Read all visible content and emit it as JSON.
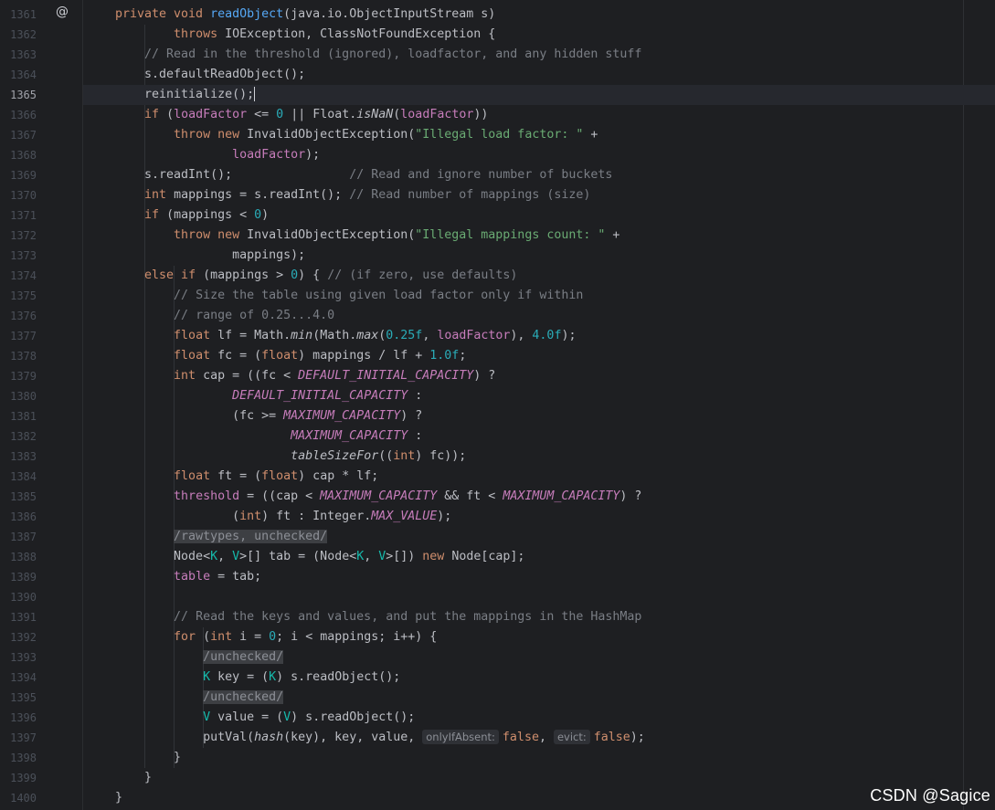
{
  "editor": {
    "gutter_icon": "at-override-icon",
    "active_line": 1365,
    "watermark": "CSDN @Sagice",
    "lines": [
      {
        "n": "1361",
        "html": "<span class=\"kw\">private void </span><span class=\"fn\">readObject</span>(java.io.ObjectInputStream s)"
      },
      {
        "n": "1362",
        "html": "        <span class=\"kw\">throws </span>IOException, ClassNotFoundException {"
      },
      {
        "n": "1363",
        "html": "    <span class=\"cm\">// Read in the threshold (ignored), loadfactor, and any hidden stuff</span>"
      },
      {
        "n": "1364",
        "html": "    s.defaultReadObject();"
      },
      {
        "n": "1365",
        "html": "    reinitialize();<span class=\"caret\"></span>"
      },
      {
        "n": "1366",
        "html": "    <span class=\"kw\">if </span>(<span class=\"field\">loadFactor</span> &lt;= <span class=\"num\">0</span> || Float.<span class=\"it\">isNaN</span>(<span class=\"field\">loadFactor</span>))"
      },
      {
        "n": "1367",
        "html": "        <span class=\"kw\">throw new </span>InvalidObjectException(<span class=\"str\">\"Illegal load factor: \"</span> +"
      },
      {
        "n": "1368",
        "html": "                <span class=\"field\">loadFactor</span>);"
      },
      {
        "n": "1369",
        "html": "    s.readInt();                <span class=\"cm\">// Read and ignore number of buckets</span>"
      },
      {
        "n": "1370",
        "html": "    <span class=\"kw\">int </span>mappings = s.readInt(); <span class=\"cm\">// Read number of mappings (size)</span>"
      },
      {
        "n": "1371",
        "html": "    <span class=\"kw\">if </span>(mappings &lt; <span class=\"num\">0</span>)"
      },
      {
        "n": "1372",
        "html": "        <span class=\"kw\">throw new </span>InvalidObjectException(<span class=\"str\">\"Illegal mappings count: \"</span> +"
      },
      {
        "n": "1373",
        "html": "                mappings);"
      },
      {
        "n": "1374",
        "html": "    <span class=\"kw\">else if </span>(mappings &gt; <span class=\"num\">0</span>) { <span class=\"cm\">// (if zero, use defaults)</span>"
      },
      {
        "n": "1375",
        "html": "        <span class=\"cm\">// Size the table using given load factor only if within</span>"
      },
      {
        "n": "1376",
        "html": "        <span class=\"cm\">// range of 0.25...4.0</span>"
      },
      {
        "n": "1377",
        "html": "        <span class=\"kw\">float </span>lf = Math.<span class=\"it\">min</span>(Math.<span class=\"it\">max</span>(<span class=\"num\">0.25f</span>, <span class=\"field\">loadFactor</span>), <span class=\"num\">4.0f</span>);"
      },
      {
        "n": "1378",
        "html": "        <span class=\"kw\">float </span>fc = (<span class=\"kw\">float</span>) mappings / lf + <span class=\"num\">1.0f</span>;"
      },
      {
        "n": "1379",
        "html": "        <span class=\"kw\">int </span>cap = ((fc &lt; <span class=\"const\">DEFAULT_INITIAL_CAPACITY</span>) ?"
      },
      {
        "n": "1380",
        "html": "                <span class=\"const\">DEFAULT_INITIAL_CAPACITY</span> :"
      },
      {
        "n": "1381",
        "html": "                (fc &gt;= <span class=\"const\">MAXIMUM_CAPACITY</span>) ?"
      },
      {
        "n": "1382",
        "html": "                        <span class=\"const\">MAXIMUM_CAPACITY</span> :"
      },
      {
        "n": "1383",
        "html": "                        <span class=\"it\">tableSizeFor</span>((<span class=\"kw\">int</span>) fc));"
      },
      {
        "n": "1384",
        "html": "        <span class=\"kw\">float </span>ft = (<span class=\"kw\">float</span>) cap * lf;"
      },
      {
        "n": "1385",
        "html": "        <span class=\"field\">threshold</span> = ((cap &lt; <span class=\"const\">MAXIMUM_CAPACITY</span> &amp;&amp; ft &lt; <span class=\"const\">MAXIMUM_CAPACITY</span>) ?"
      },
      {
        "n": "1386",
        "html": "                (<span class=\"kw\">int</span>) ft : Integer.<span class=\"const\">MAX_VALUE</span>);"
      },
      {
        "n": "1387",
        "html": "        <span class=\"sup\">/rawtypes, unchecked/</span>"
      },
      {
        "n": "1388",
        "html": "        Node&lt;<span class=\"tp\">K</span>, <span class=\"tp\">V</span>&gt;[] tab = (Node&lt;<span class=\"tp\">K</span>, <span class=\"tp\">V</span>&gt;[]) <span class=\"kw\">new </span>Node[cap];"
      },
      {
        "n": "1389",
        "html": "        <span class=\"field\">table</span> = tab;"
      },
      {
        "n": "1390",
        "html": ""
      },
      {
        "n": "1391",
        "html": "        <span class=\"cm\">// Read the keys and values, and put the mappings in the HashMap</span>"
      },
      {
        "n": "1392",
        "html": "        <span class=\"kw\">for </span>(<span class=\"kw\">int </span>i = <span class=\"num\">0</span>; i &lt; mappings; i++) {"
      },
      {
        "n": "1393",
        "html": "            <span class=\"sup\">/unchecked/</span>"
      },
      {
        "n": "1394",
        "html": "            <span class=\"tp\">K</span> key = (<span class=\"tp\">K</span>) s.readObject();"
      },
      {
        "n": "1395",
        "html": "            <span class=\"sup\">/unchecked/</span>"
      },
      {
        "n": "1396",
        "html": "            <span class=\"tp\">V</span> value = (<span class=\"tp\">V</span>) s.readObject();"
      },
      {
        "n": "1397",
        "html": "            putVal(<span class=\"it\">hash</span>(key), key, value, <span class=\"hint\">onlyIfAbsent:</span><span class=\"kw\">false</span>, <span class=\"hint\">evict:</span><span class=\"kw\">false</span>);"
      },
      {
        "n": "1398",
        "html": "        }"
      },
      {
        "n": "1399",
        "html": "    }"
      },
      {
        "n": "1400",
        "html": "}"
      }
    ]
  }
}
